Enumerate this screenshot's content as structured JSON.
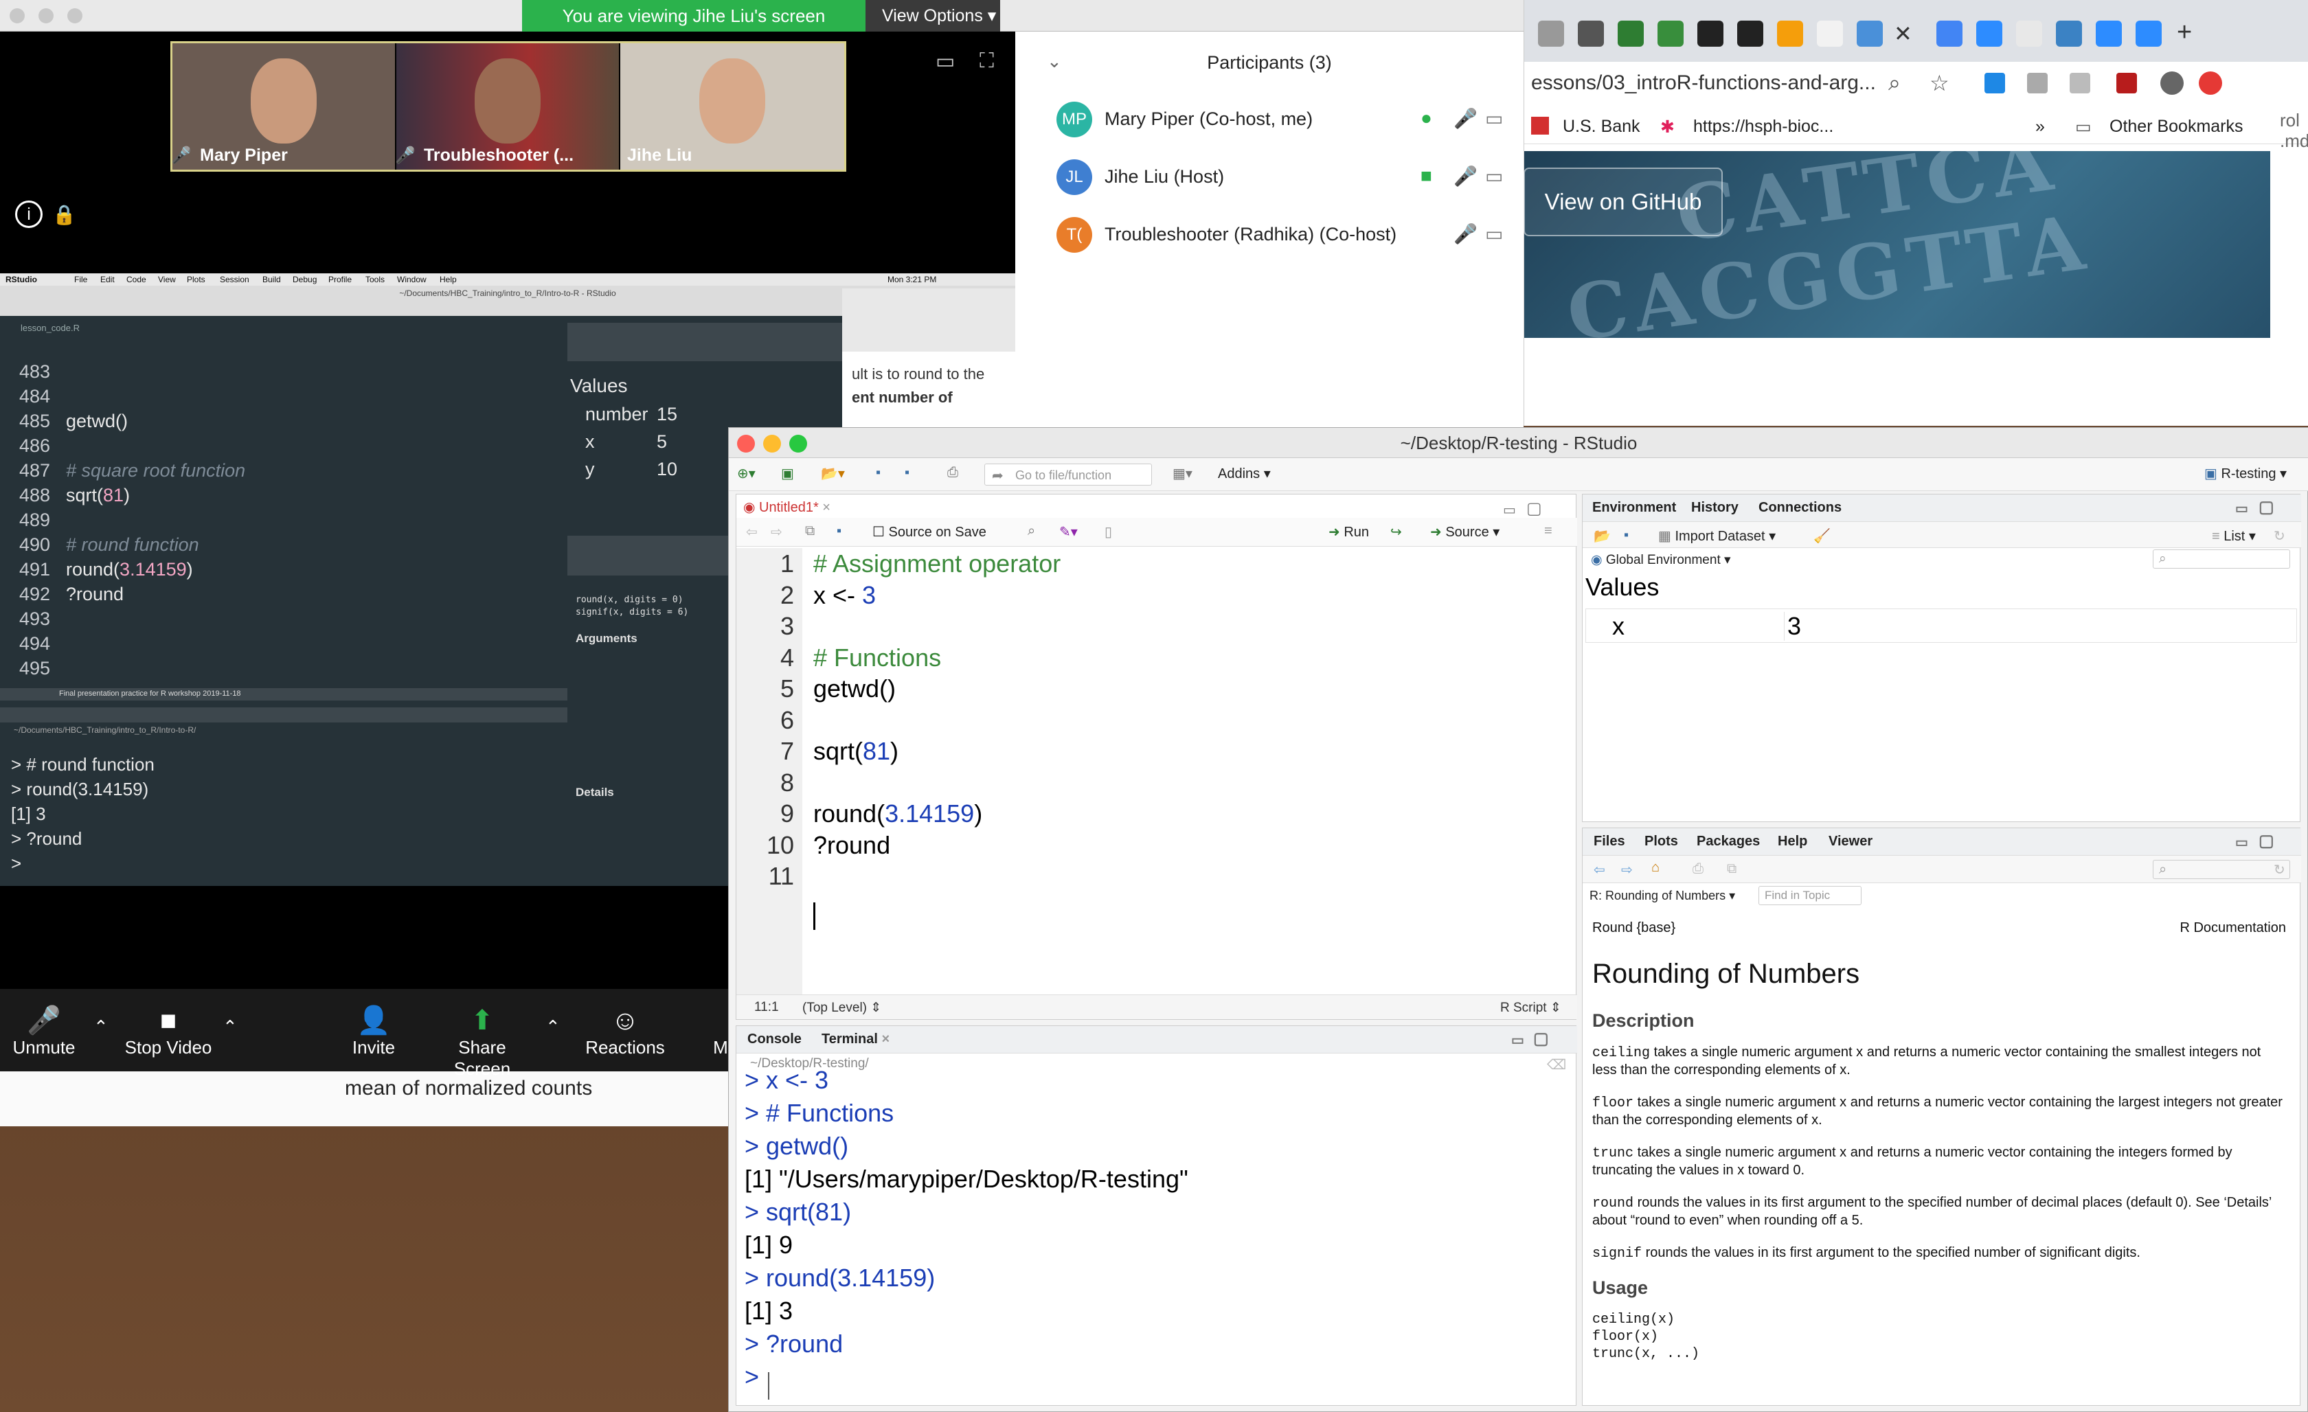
{
  "zoom": {
    "banner": "You are viewing Jihe Liu's screen",
    "view_options": "View Options ▾",
    "videos": [
      {
        "name": "Mary Piper",
        "muted": true
      },
      {
        "name": "Troubleshooter (...",
        "muted": true
      },
      {
        "name": "Jihe Liu",
        "muted": false
      }
    ],
    "controls": [
      "Unmute",
      "Stop Video",
      "Invite",
      "Share Screen",
      "Reactions",
      "M"
    ]
  },
  "participants": {
    "title": "Participants (3)",
    "list": [
      {
        "initials": "MP",
        "name": "Mary Piper (Co-host, me)",
        "color": "#2bb5a4"
      },
      {
        "initials": "JL",
        "name": "Jihe Liu (Host)",
        "color": "#3f7fd1"
      },
      {
        "initials": "T(",
        "name": "Troubleshooter (Radhika) (Co-host)",
        "color": "#e97d2a"
      }
    ]
  },
  "browser": {
    "url": "essons/03_introR-functions-and-arg...",
    "bookmarks": [
      "U.S. Bank",
      "https://hsph-bioc...",
      "»",
      "Other Bookmarks"
    ],
    "github_button": "View on GitHub",
    "side_text": [
      "rol",
      ".md"
    ]
  },
  "background_doc": {
    "text": "mean of normalized counts"
  },
  "shared_rstudio": {
    "menu": [
      "RStudio",
      "File",
      "Edit",
      "Code",
      "View",
      "Plots",
      "Session",
      "Build",
      "Debug",
      "Profile",
      "Tools",
      "Window",
      "Help"
    ],
    "clock": "Mon 3:21 PM",
    "path": "~/Documents/HBC_Training/intro_to_R/Intro-to-R - RStudio",
    "file_tab": "lesson_code.R",
    "lines": [
      {
        "n": "483",
        "code": ""
      },
      {
        "n": "484",
        "code": ""
      },
      {
        "n": "485",
        "code": "getwd()"
      },
      {
        "n": "486",
        "code": ""
      },
      {
        "n": "487",
        "code": "# square root function"
      },
      {
        "n": "488",
        "code": "sqrt(81)"
      },
      {
        "n": "489",
        "code": ""
      },
      {
        "n": "490",
        "code": "# round function"
      },
      {
        "n": "491",
        "code": "round(3.14159)"
      },
      {
        "n": "492",
        "code": "?round"
      },
      {
        "n": "493",
        "code": ""
      },
      {
        "n": "494",
        "code": ""
      },
      {
        "n": "495",
        "code": ""
      }
    ],
    "status": "Final presentation practice for R workshop 2019-11-18",
    "console_path": "~/Documents/HBC_Training/intro_to_R/Intro-to-R/",
    "console": [
      "> # round function",
      "> round(3.14159)",
      "[1] 3",
      "> ?round",
      ">"
    ],
    "env_values_header": "Values",
    "env_values": [
      {
        "name": "number",
        "value": "15"
      },
      {
        "name": "x",
        "value": "5"
      },
      {
        "name": "y",
        "value": "10"
      }
    ],
    "help_usage": [
      "round(x, digits = 0)",
      "signif(x, digits = 6)"
    ],
    "help_args_title": "Arguments",
    "help_details_title": "Details",
    "web_text_1": "ult is to round to the",
    "web_text_2": "ent number of"
  },
  "rstudio": {
    "title": "~/Desktop/R-testing - RStudio",
    "project": "R-testing",
    "go_to": "Go to file/function",
    "addins": "Addins",
    "editor": {
      "tab": "Untitled1*",
      "source_on_save": "Source on Save",
      "run": "Run",
      "source": "Source",
      "lines": [
        {
          "n": "1",
          "code": "# Assignment operator",
          "type": "comment"
        },
        {
          "n": "2",
          "code": "x <- 3",
          "type": "code"
        },
        {
          "n": "3",
          "code": "",
          "type": "code"
        },
        {
          "n": "4",
          "code": "# Functions",
          "type": "comment"
        },
        {
          "n": "5",
          "code": "getwd()",
          "type": "code"
        },
        {
          "n": "6",
          "code": "",
          "type": "code"
        },
        {
          "n": "7",
          "code": "sqrt(81)",
          "type": "code"
        },
        {
          "n": "8",
          "code": "",
          "type": "code"
        },
        {
          "n": "9",
          "code": "round(3.14159)",
          "type": "code"
        },
        {
          "n": "10",
          "code": "?round",
          "type": "code"
        },
        {
          "n": "11",
          "code": "",
          "type": "code"
        }
      ],
      "position": "11:1",
      "scope": "(Top Level)",
      "filetype": "R Script"
    },
    "console": {
      "tabs": [
        "Console",
        "Terminal"
      ],
      "path": "~/Desktop/R-testing/",
      "lines": [
        {
          "text": "> x <- 3",
          "kind": "prompt"
        },
        {
          "text": "> # Functions",
          "kind": "prompt"
        },
        {
          "text": "> getwd()",
          "kind": "prompt"
        },
        {
          "text": "[1] \"/Users/marypiper/Desktop/R-testing\"",
          "kind": "out"
        },
        {
          "text": "> sqrt(81)",
          "kind": "prompt"
        },
        {
          "text": "[1] 9",
          "kind": "out"
        },
        {
          "text": "> round(3.14159)",
          "kind": "prompt"
        },
        {
          "text": "[1] 3",
          "kind": "out"
        },
        {
          "text": "> ?round",
          "kind": "prompt"
        },
        {
          "text": ">",
          "kind": "prompt"
        }
      ]
    },
    "environment": {
      "tabs": [
        "Environment",
        "History",
        "Connections"
      ],
      "import": "Import Dataset",
      "list": "List",
      "scope": "Global Environment",
      "values_header": "Values",
      "var_name": "x",
      "var_value": "3"
    },
    "help": {
      "tabs": [
        "Files",
        "Plots",
        "Packages",
        "Help",
        "Viewer"
      ],
      "topic": "R: Rounding of Numbers",
      "find": "Find in Topic",
      "pkg": "Round {base}",
      "doc": "R Documentation",
      "title": "Rounding of Numbers",
      "desc_title": "Description",
      "desc": [
        {
          "fn": "ceiling",
          "text": " takes a single numeric argument x and returns a numeric vector containing the smallest integers not less than the corresponding elements of x."
        },
        {
          "fn": "floor",
          "text": " takes a single numeric argument x and returns a numeric vector containing the largest integers not greater than the corresponding elements of x."
        },
        {
          "fn": "trunc",
          "text": " takes a single numeric argument x and returns a numeric vector containing the integers formed by truncating the values in x toward 0."
        },
        {
          "fn": "round",
          "text": " rounds the values in its first argument to the specified number of decimal places (default 0). See ‘Details’ about “round to even” when rounding off a 5."
        },
        {
          "fn": "signif",
          "text": " rounds the values in its first argument to the specified number of significant digits."
        }
      ],
      "usage_title": "Usage",
      "usage": [
        "ceiling(x)",
        "floor(x)",
        "trunc(x, ...)"
      ]
    }
  }
}
